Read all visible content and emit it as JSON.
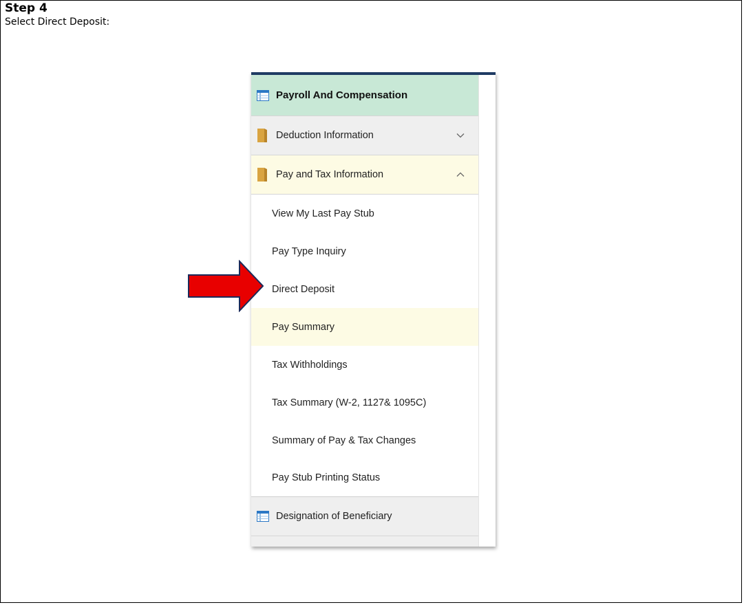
{
  "instructions": {
    "step": "Step 4",
    "text": "Select Direct Deposit:"
  },
  "menu": {
    "header": {
      "label": "Payroll And Compensation",
      "icon": "table-icon"
    },
    "sections": [
      {
        "label": "Deduction Information",
        "icon": "folder-icon",
        "state": "collapsed"
      },
      {
        "label": "Pay and Tax Information",
        "icon": "folder-icon",
        "state": "expanded"
      }
    ],
    "items": [
      "View My Last Pay Stub",
      "Pay Type Inquiry",
      "Direct Deposit",
      "Pay Summary",
      "Tax Withholdings",
      "Tax Summary (W-2, 1127& 1095C)",
      "Summary of Pay & Tax Changes",
      "Pay Stub Printing Status"
    ],
    "highlighted_item": "Pay Summary",
    "footer_section": {
      "label": "Designation of Beneficiary",
      "icon": "table-icon"
    }
  },
  "colors": {
    "header_bg": "#c8e8d6",
    "topbar": "#1f3b63",
    "highlight_bg": "#fdfbe4",
    "arrow": "#e80000",
    "folder": "#d9a441",
    "table_icon": "#2b78c5"
  }
}
